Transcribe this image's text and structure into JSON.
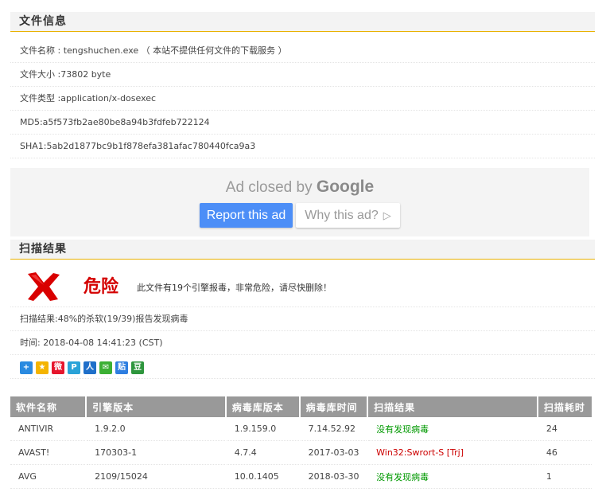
{
  "file_info": {
    "header": "文件信息",
    "name_row": "文件名称 : tengshuchen.exe （ 本站不提供任何文件的下载服务 ）",
    "size_row": "文件大小 :73802 byte",
    "type_row": "文件类型 :application/x-dosexec",
    "md5_row": "MD5:a5f573fb2ae80be8a94b3fdfeb722124",
    "sha1_row": "SHA1:5ab2d1877bc9b1f878efa381afac780440fca9a3"
  },
  "ad": {
    "closed_text": "Ad closed by",
    "brand": "Google",
    "report_label": "Report this ad",
    "why_label": "Why this ad?",
    "why_icon": "▷"
  },
  "scan": {
    "header": "扫描结果",
    "danger_icon": "red-x-icon",
    "danger_title": "危险",
    "danger_message": "此文件有19个引擎报毒，非常危险，请尽快删除！",
    "result_row": "扫描结果:48%的杀软(19/39)报告发现病毒",
    "time_row": "时间: 2018-04-08 14:41:23 (CST)"
  },
  "share_icons": [
    {
      "name": "share-more-icon",
      "glyph": "+",
      "color": "#2a8ae0"
    },
    {
      "name": "share-qzone-icon",
      "glyph": "★",
      "color": "#f4b400"
    },
    {
      "name": "share-weibo-icon",
      "glyph": "微",
      "color": "#e6162d"
    },
    {
      "name": "share-tencent-icon",
      "glyph": "P",
      "color": "#2aa3d8"
    },
    {
      "name": "share-renren-icon",
      "glyph": "人",
      "color": "#1f6fc9"
    },
    {
      "name": "share-wechat-icon",
      "glyph": "✉",
      "color": "#3cb034"
    },
    {
      "name": "share-tieba-icon",
      "glyph": "贴",
      "color": "#2e7ee0"
    },
    {
      "name": "share-douban-icon",
      "glyph": "豆",
      "color": "#2e963d"
    }
  ],
  "table": {
    "headers": [
      "软件名称",
      "引擎版本",
      "病毒库版本",
      "病毒库时间",
      "扫描结果",
      "扫描耗时"
    ],
    "rows": [
      {
        "name": "ANTIVIR",
        "engine": "1.9.2.0",
        "db_version": "1.9.159.0",
        "db_time": "7.14.52.92",
        "result": "没有发现病毒",
        "status": "ok",
        "duration": "24"
      },
      {
        "name": "AVAST!",
        "engine": "170303-1",
        "db_version": "4.7.4",
        "db_time": "2017-03-03",
        "result": "Win32:Swrort-S [Trj]",
        "status": "bad",
        "duration": "46"
      },
      {
        "name": "AVG",
        "engine": "2109/15024",
        "db_version": "10.0.1405",
        "db_time": "2018-03-30",
        "result": "没有发现病毒",
        "status": "ok",
        "duration": "1"
      }
    ]
  },
  "colors": {
    "accent_line": "#e8b100",
    "danger_red": "#d40000",
    "clean_green": "#009900",
    "header_gray": "#999999"
  }
}
